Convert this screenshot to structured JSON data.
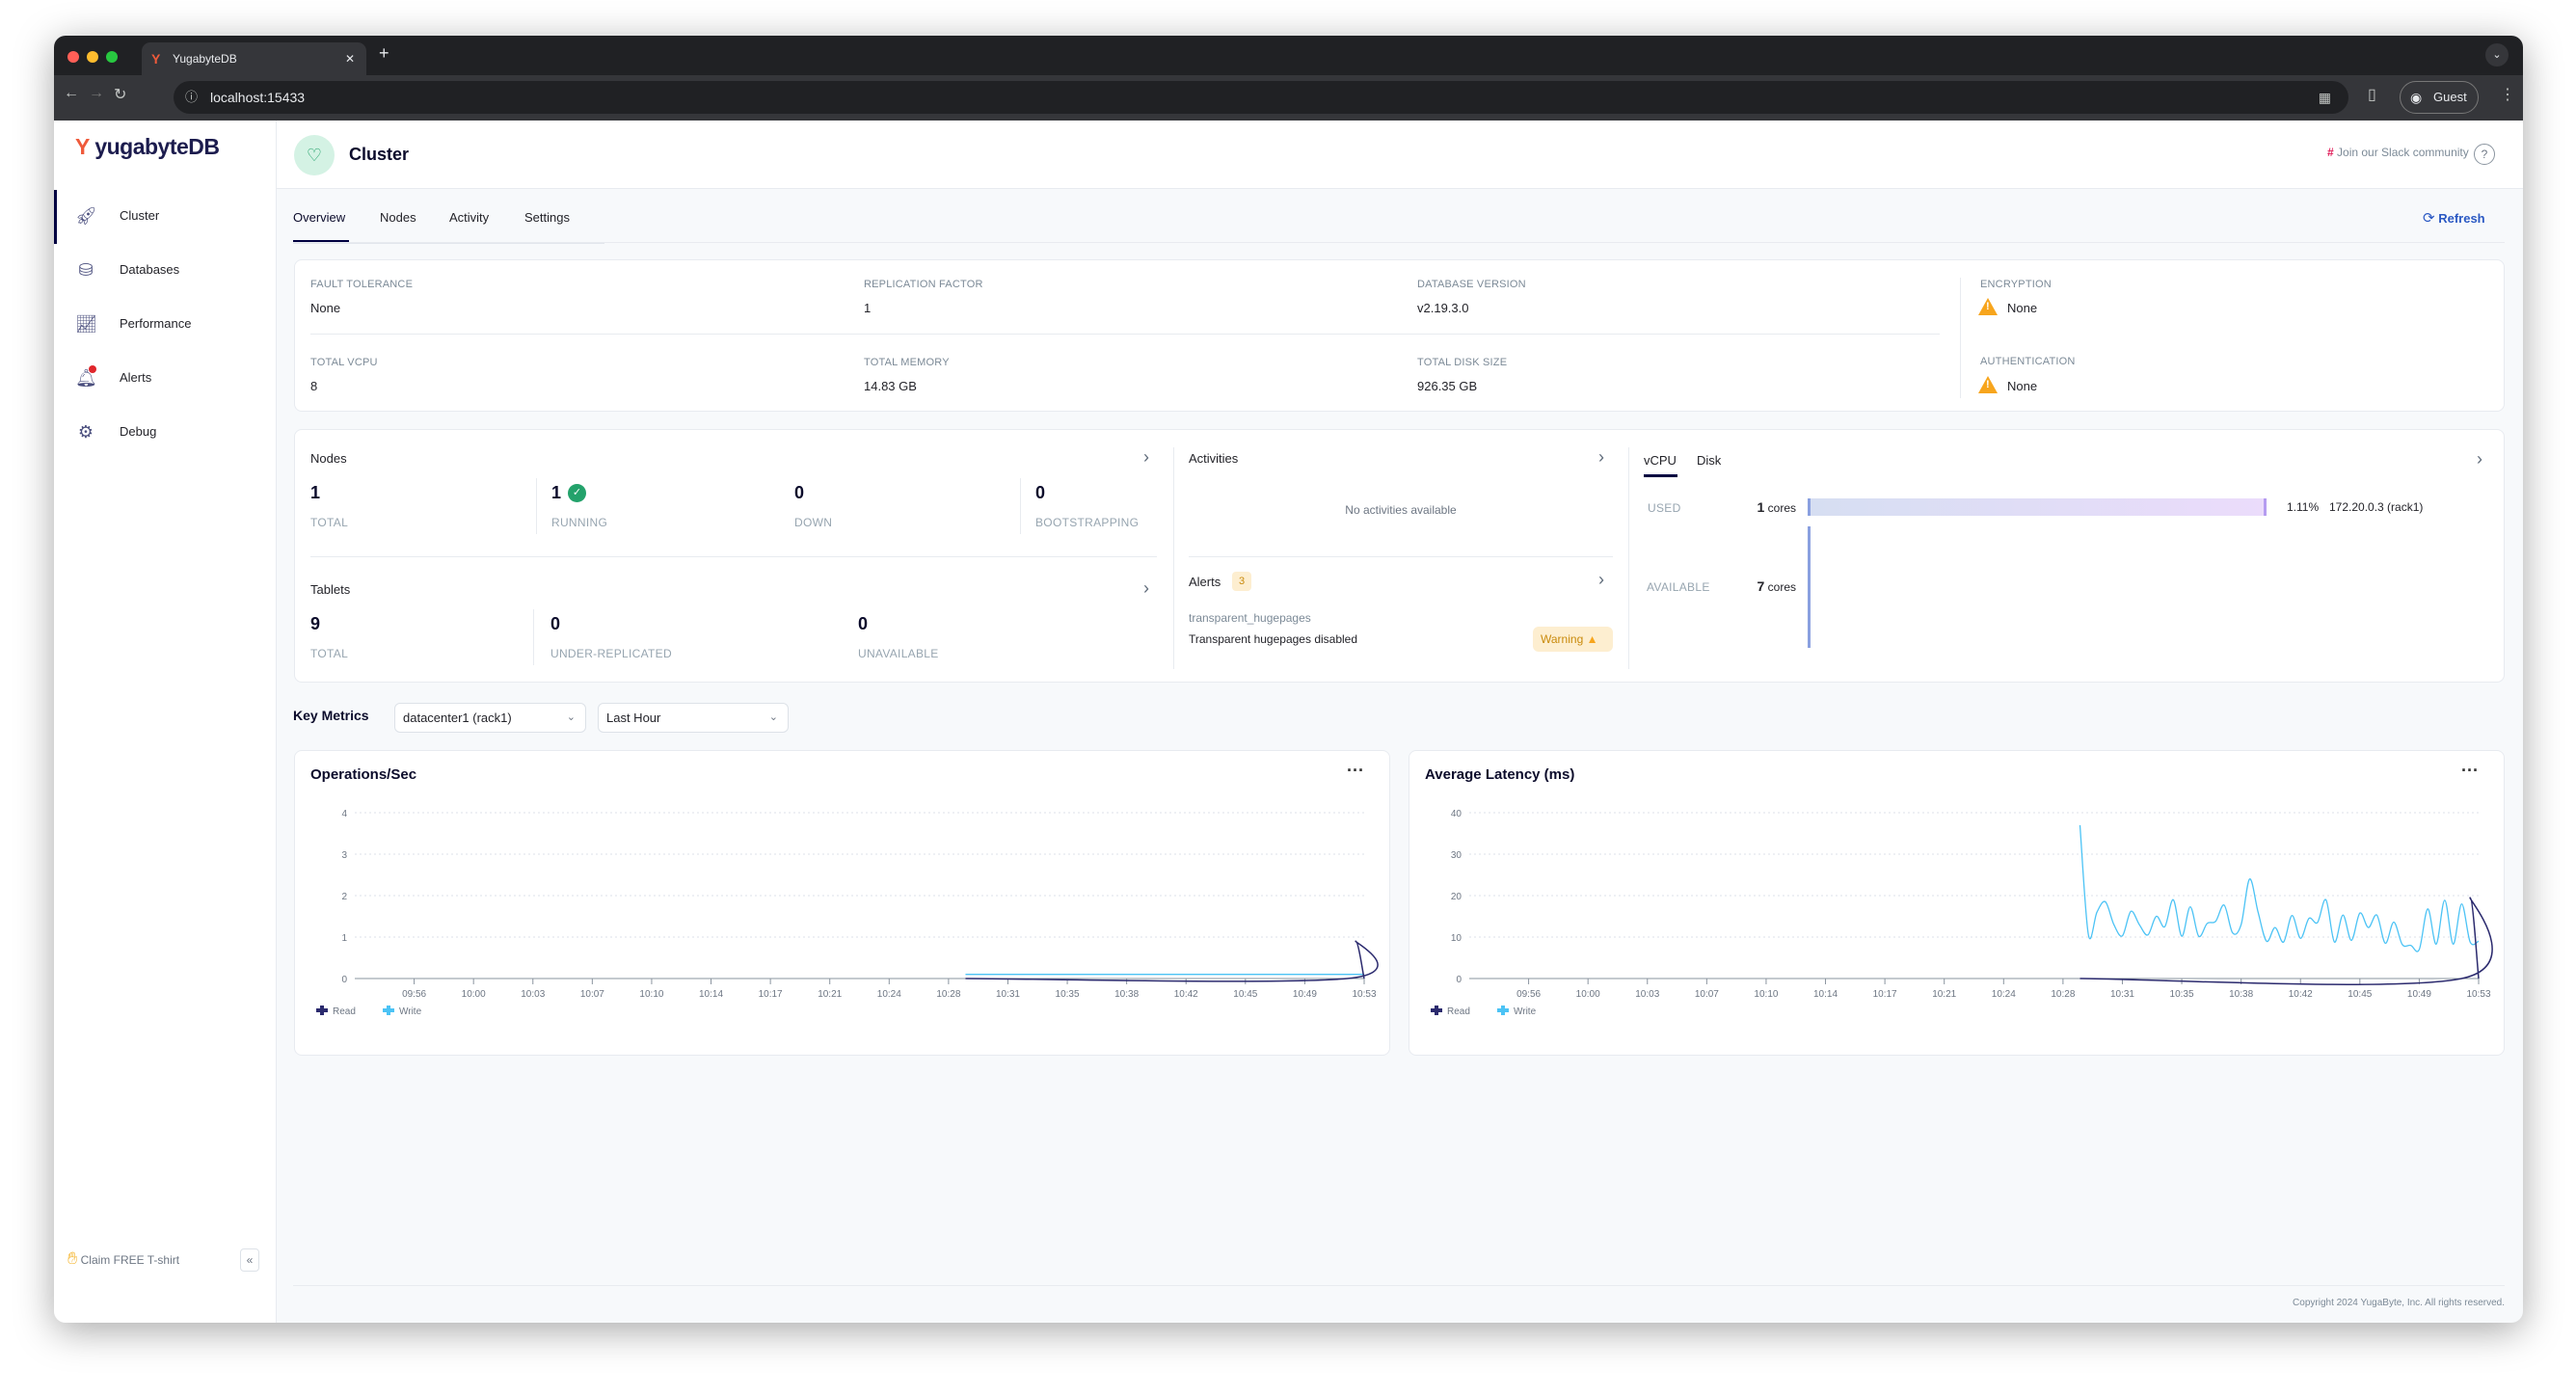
{
  "browser": {
    "tab_title": "YugabyteDB",
    "url": "localhost:15433",
    "profile": "Guest"
  },
  "sidebar": {
    "logo": "yugabyteDB",
    "items": [
      {
        "label": "Cluster",
        "icon": "rocket-icon",
        "active": true
      },
      {
        "label": "Databases",
        "icon": "database-icon"
      },
      {
        "label": "Performance",
        "icon": "chart-line-icon"
      },
      {
        "label": "Alerts",
        "icon": "bell-icon",
        "badge_dot": true
      },
      {
        "label": "Debug",
        "icon": "gear-icon"
      }
    ],
    "promo": "Claim FREE T-shirt",
    "collapse": "«"
  },
  "header": {
    "title": "Cluster",
    "slack": "Join our Slack community",
    "help": "?"
  },
  "tabs": [
    {
      "label": "Overview",
      "active": true
    },
    {
      "label": "Nodes"
    },
    {
      "label": "Activity"
    },
    {
      "label": "Settings"
    }
  ],
  "refresh": "Refresh",
  "info": {
    "fault_tolerance": {
      "label": "Fault Tolerance",
      "value": "None"
    },
    "replication_factor": {
      "label": "Replication Factor",
      "value": "1"
    },
    "database_version": {
      "label": "Database Version",
      "value": "v2.19.3.0"
    },
    "encryption": {
      "label": "Encryption",
      "value": "None"
    },
    "total_vcpu": {
      "label": "Total vCPU",
      "value": "8"
    },
    "total_memory": {
      "label": "Total Memory",
      "value": "14.83 GB"
    },
    "total_disk": {
      "label": "Total Disk Size",
      "value": "926.35 GB"
    },
    "authentication": {
      "label": "Authentication",
      "value": "None"
    }
  },
  "nodes": {
    "title": "Nodes",
    "stats": [
      {
        "value": "1",
        "label": "TOTAL"
      },
      {
        "value": "1",
        "label": "RUNNING"
      },
      {
        "value": "0",
        "label": "DOWN"
      },
      {
        "value": "0",
        "label": "BOOTSTRAPPING"
      }
    ]
  },
  "tablets": {
    "title": "Tablets",
    "stats": [
      {
        "value": "9",
        "label": "TOTAL"
      },
      {
        "value": "0",
        "label": "UNDER-REPLICATED"
      },
      {
        "value": "0",
        "label": "UNAVAILABLE"
      }
    ]
  },
  "activities": {
    "title": "Activities",
    "empty": "No activities available"
  },
  "alerts": {
    "title": "Alerts",
    "count": "3",
    "item_name": "transparent_hugepages",
    "item_desc": "Transparent hugepages disabled",
    "severity": "Warning"
  },
  "resources": {
    "tabs": [
      {
        "label": "vCPU",
        "active": true
      },
      {
        "label": "Disk"
      }
    ],
    "used_label": "USED",
    "used_value": "1",
    "used_unit": "cores",
    "available_label": "AVAILABLE",
    "available_value": "7",
    "available_unit": "cores",
    "node_percent": "1.11%",
    "node_percent_value": 1.11,
    "node_name": "172.20.0.3 (rack1)"
  },
  "key_metrics": {
    "title": "Key Metrics",
    "region": "datacenter1 (rack1)",
    "range": "Last Hour"
  },
  "colors": {
    "read": "#2b2a6e",
    "write": "#4cc3f5",
    "accent": "#2b59c3",
    "warning": "#f7a51d"
  },
  "chart_data": [
    {
      "type": "line",
      "title": "Operations/Sec",
      "xlim": [
        "09:53:30",
        "10:53:00"
      ],
      "ylim": [
        0,
        4
      ],
      "yticks": [
        "0",
        "1",
        "2",
        "3",
        "4"
      ],
      "xticks": [
        "09:56",
        "10:00",
        "10:03",
        "10:07",
        "10:10",
        "10:14",
        "10:17",
        "10:21",
        "10:24",
        "10:28",
        "10:31",
        "10:35",
        "10:38",
        "10:42",
        "10:45",
        "10:49",
        "10:53"
      ],
      "grid": true,
      "legend": "bottom-left",
      "series": [
        {
          "name": "Read",
          "points": [
            [
              "10:29:30",
              0
            ],
            [
              "10:52:00",
              0
            ],
            [
              "10:52:30",
              0.9
            ],
            [
              "10:53:00",
              0
            ]
          ]
        },
        {
          "name": "Write",
          "points": [
            [
              "10:29:30",
              0.1
            ],
            [
              "10:53:00",
              0.1
            ]
          ]
        }
      ]
    },
    {
      "type": "line",
      "title": "Average Latency (ms)",
      "xlim": [
        "09:53:30",
        "10:53:00"
      ],
      "ylim": [
        0,
        40
      ],
      "yticks": [
        "0",
        "10",
        "20",
        "30",
        "40"
      ],
      "xticks": [
        "09:56",
        "10:00",
        "10:03",
        "10:07",
        "10:10",
        "10:14",
        "10:17",
        "10:21",
        "10:24",
        "10:28",
        "10:31",
        "10:35",
        "10:38",
        "10:42",
        "10:45",
        "10:49",
        "10:53"
      ],
      "grid": true,
      "legend": "bottom-left",
      "series": [
        {
          "name": "Read",
          "points": [
            [
              "10:29:30",
              0
            ],
            [
              "10:52:00",
              0
            ],
            [
              "10:52:30",
              19.5
            ],
            [
              "10:53:00",
              0
            ]
          ]
        },
        {
          "name": "Write",
          "points": [
            [
              "10:29:30",
              37
            ],
            [
              "10:30:00",
              10.5
            ],
            [
              "10:30:30",
              16
            ],
            [
              "10:31:00",
              18.5
            ],
            [
              "10:31:30",
              13
            ],
            [
              "10:32:00",
              10.3
            ],
            [
              "10:32:30",
              16.2
            ],
            [
              "10:33:00",
              13
            ],
            [
              "10:33:30",
              10.5
            ],
            [
              "10:34:00",
              15
            ],
            [
              "10:34:30",
              12.5
            ],
            [
              "10:35:00",
              19
            ],
            [
              "10:35:30",
              10.2
            ],
            [
              "10:36:00",
              17.3
            ],
            [
              "10:36:30",
              10.2
            ],
            [
              "10:37:00",
              13.3
            ],
            [
              "10:37:30",
              13.8
            ],
            [
              "10:38:00",
              17.7
            ],
            [
              "10:38:30",
              11
            ],
            [
              "10:39:00",
              13
            ],
            [
              "10:39:30",
              24
            ],
            [
              "10:40:00",
              16
            ],
            [
              "10:40:30",
              9
            ],
            [
              "10:41:00",
              12.3
            ],
            [
              "10:41:30",
              8.8
            ],
            [
              "10:42:00",
              15.2
            ],
            [
              "10:42:30",
              9.7
            ],
            [
              "10:43:00",
              14.5
            ],
            [
              "10:43:30",
              13.5
            ],
            [
              "10:44:00",
              19
            ],
            [
              "10:44:30",
              8.8
            ],
            [
              "10:45:00",
              15.3
            ],
            [
              "10:45:30",
              9.2
            ],
            [
              "10:46:00",
              15.8
            ],
            [
              "10:46:30",
              12.3
            ],
            [
              "10:47:00",
              15.3
            ],
            [
              "10:47:30",
              8.5
            ],
            [
              "10:48:00",
              13.6
            ],
            [
              "10:48:30",
              8.2
            ],
            [
              "10:49:00",
              8
            ],
            [
              "10:49:30",
              7
            ],
            [
              "10:50:00",
              16.8
            ],
            [
              "10:50:30",
              8.3
            ],
            [
              "10:51:00",
              18.9
            ],
            [
              "10:51:30",
              8.3
            ],
            [
              "10:52:00",
              18
            ],
            [
              "10:52:30",
              8.8
            ],
            [
              "10:53:00",
              9
            ]
          ]
        }
      ]
    }
  ],
  "footer": "Copyright 2024 YugaByte, Inc. All rights reserved."
}
